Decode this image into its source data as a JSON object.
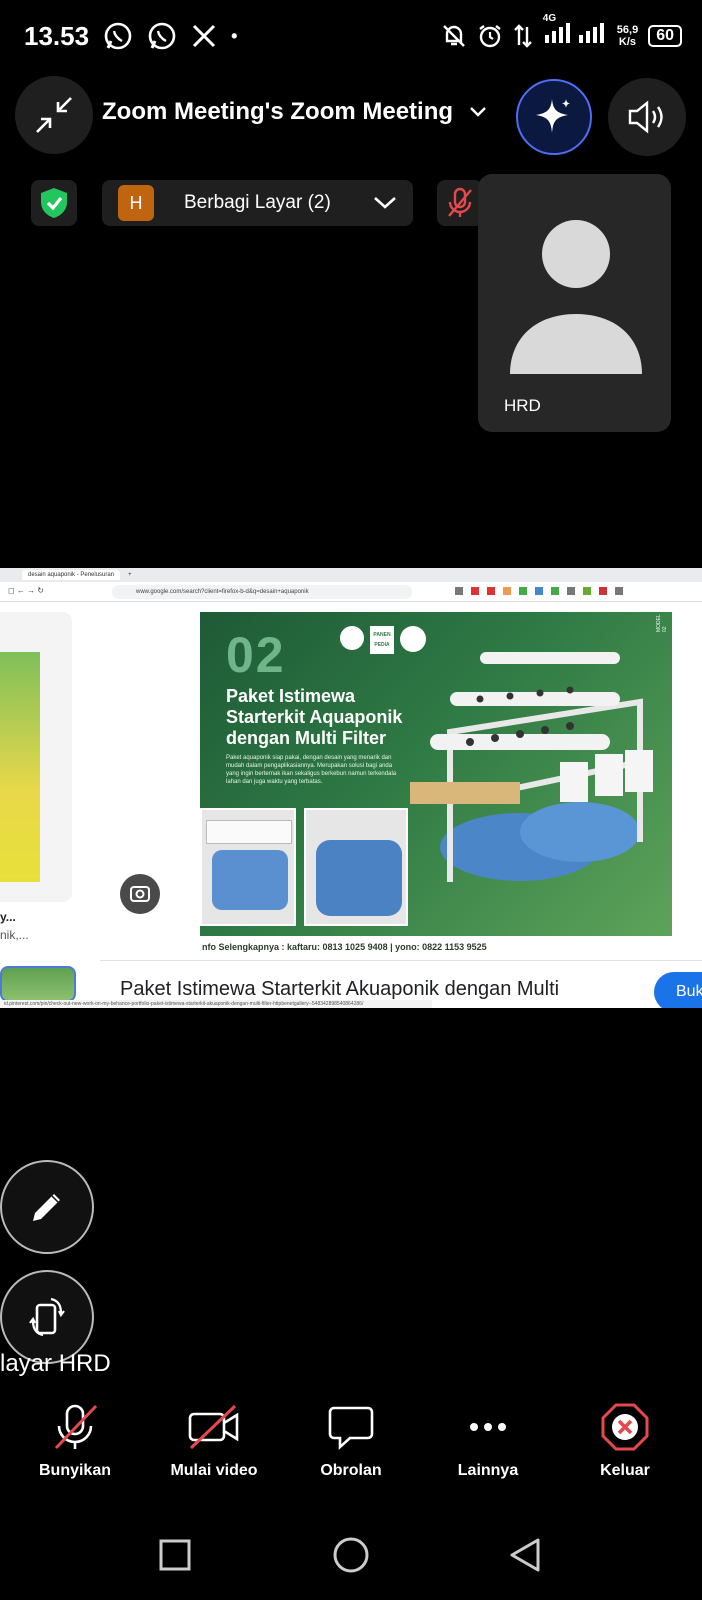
{
  "status_bar": {
    "time": "13.53",
    "network": "4G",
    "speed_value": "56,9",
    "speed_unit": "K/s",
    "battery": "60"
  },
  "header": {
    "meeting_title": "Zoom Meeting's Zoom Meeting"
  },
  "share_bar": {
    "avatar_initial": "H",
    "label": "Berbagi Layar (2)"
  },
  "participant": {
    "name": "HRD"
  },
  "shared_screen": {
    "tab_title": "desain aquaponik - Penelusuran",
    "url": "www.google.com/search?client=firefox-b-d&q=desain+aquaponik",
    "poster": {
      "number": "02",
      "title_line1": "Paket Istimewa",
      "title_line2": "Starterkit Aquaponik",
      "title_line3": "dengan Multi Filter",
      "brand1": "PANEN PEDIA",
      "description": "Paket aquaponik siap pakai, dengan desain yang menarik dan mudah dalam pengaplikasiannya. Merupakan solusi bagi anda yang ingin berternak ikan sekaligus berkebun namun terkendala lahan dan juga waktu yang terbatas.",
      "model_label": "MODEL 02",
      "footer": "nfo Selengkapnya : kaftaru: 0813 1025 9408  |  yono: 0822 1153 9525"
    },
    "left_partial_text1": "y...",
    "left_partial_text2": "nik,...",
    "result_title": "Paket Istimewa Starterkit Akuaponik dengan Multi",
    "result_button": "Buk",
    "status_url": "id.pinterest.com/pin/check-out-new-work-on-my-behance-portfolio-paket-istimewa-starterkit-akuaponik-dengan-multi-filter-httpbenetgallery--548342898540864286/"
  },
  "floating": {
    "caption": "layar HRD"
  },
  "toolbar": {
    "items": [
      {
        "label": "Bunyikan"
      },
      {
        "label": "Mulai video"
      },
      {
        "label": "Obrolan"
      },
      {
        "label": "Lainnya"
      },
      {
        "label": "Keluar"
      }
    ]
  },
  "colors": {
    "accent_blue": "#3b5bdb",
    "danger_red": "#e5484d",
    "shield_green": "#22c55e",
    "avatar_orange": "#c0650f"
  }
}
